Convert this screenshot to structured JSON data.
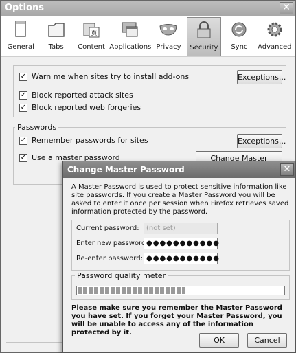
{
  "window": {
    "title": "Options",
    "close_glyph": "✕"
  },
  "toolbar": {
    "items": [
      {
        "label": "General",
        "icon": "general-icon"
      },
      {
        "label": "Tabs",
        "icon": "tabs-icon"
      },
      {
        "label": "Content",
        "icon": "content-icon"
      },
      {
        "label": "Applications",
        "icon": "applications-icon"
      },
      {
        "label": "Privacy",
        "icon": "privacy-icon"
      },
      {
        "label": "Security",
        "icon": "security-icon",
        "selected": true
      },
      {
        "label": "Sync",
        "icon": "sync-icon"
      },
      {
        "label": "Advanced",
        "icon": "advanced-icon"
      }
    ]
  },
  "security": {
    "warn_addons": {
      "label": "Warn me when sites try to install add-ons",
      "checked": true
    },
    "block_attack": {
      "label": "Block reported attack sites",
      "checked": true
    },
    "block_forgeries": {
      "label": "Block reported web forgeries",
      "checked": true
    },
    "exceptions_label": "Exceptions..."
  },
  "passwords": {
    "group_label": "Passwords",
    "remember": {
      "label": "Remember passwords for sites",
      "checked": true
    },
    "master": {
      "label": "Use a master password",
      "checked": true
    },
    "exceptions_label": "Exceptions...",
    "change_master_label": "Change Master Password..."
  },
  "dialog": {
    "title": "Change Master Password",
    "close_glyph": "✕",
    "description": "A Master Password is used to protect sensitive information like site passwords. If you create a Master Password you will be asked to enter it once per session when Firefox retrieves saved information protected by the password.",
    "current_label": "Current password:",
    "current_placeholder": "(not set)",
    "new_label": "Enter new password:",
    "new_value": "●●●●●●●●●●●",
    "reenter_label": "Re-enter password:",
    "reenter_value": "●●●●●●●●●●●",
    "meter_label": "Password quality meter",
    "meter_value": 0.52,
    "warning": "Please make sure you remember the Master Password you have set. If you forget your Master Password, you will be unable to access any of the information protected by it.",
    "ok_label": "OK",
    "cancel_label": "Cancel"
  }
}
